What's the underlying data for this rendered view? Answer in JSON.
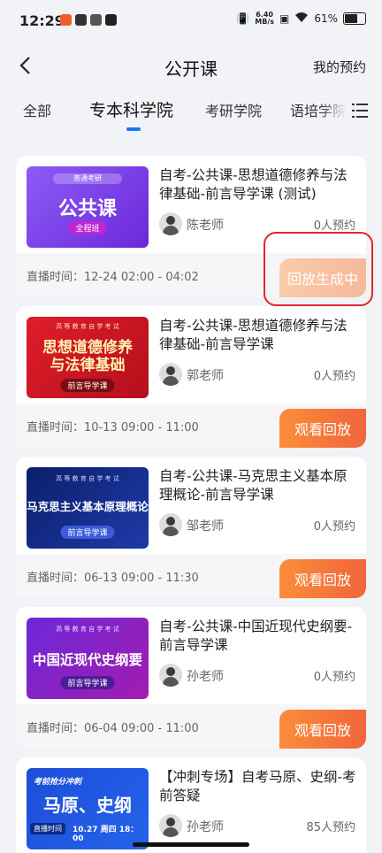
{
  "status": {
    "time": "12:29",
    "net_speed_top": "6.40",
    "net_speed_unit": "MB/s",
    "battery": "61%"
  },
  "nav": {
    "title": "公开课",
    "my_reservations": "我的预约"
  },
  "tabs": [
    {
      "label": "全部"
    },
    {
      "label": "专本科学院",
      "active": true
    },
    {
      "label": "考研学院"
    },
    {
      "label": "语培学院"
    }
  ],
  "courses": [
    {
      "title": "自考-公共课-思想道德修养与法律基础-前言导学课 (测试)",
      "teacher": "陈老师",
      "count": "0人预约",
      "airtime": "直播时间：12-24 02:00 - 04:02",
      "button": "回放生成中",
      "thumb": {
        "small": "普通考研",
        "main": "公共课",
        "pill": "全程班"
      }
    },
    {
      "title": "自考-公共课-思想道德修养与法律基础-前言导学课",
      "teacher": "郭老师",
      "count": "0人预约",
      "airtime": "直播时间：10-13 09:00 - 11:00",
      "button": "观看回放",
      "thumb": {
        "small": "高 等 教 育 自 学 考 试",
        "main1": "思想道德修养",
        "main2": "与法律基础",
        "pill": "前言导学课"
      }
    },
    {
      "title": "自考-公共课-马克思主义基本原理概论-前言导学课",
      "teacher": "邹老师",
      "count": "0人预约",
      "airtime": "直播时间：06-13 09:00 - 11:30",
      "button": "观看回放",
      "thumb": {
        "small": "高 等 教 育 自 学 考 试",
        "main": "马克思主义基本原理概论",
        "pill": "前言导学课"
      }
    },
    {
      "title": "自考-公共课-中国近现代史纲要-前言导学课",
      "teacher": "孙老师",
      "count": "0人预约",
      "airtime": "直播时间：06-04 09:00 - 11:00",
      "button": "观看回放",
      "thumb": {
        "small": "高 等 教 育 自 学 考 试",
        "main": "中国近现代史纲要",
        "pill": "前言导学课"
      }
    },
    {
      "title": "【冲刺专场】自考马原、史纲-考前答疑",
      "teacher": "孙老师",
      "count": "85人预约",
      "thumb": {
        "small": "考前抢分冲刺",
        "main": "马原、史纲",
        "pill": "直播时间",
        "date": "10.27 周四 18：00"
      }
    }
  ],
  "colors": {
    "accent": "#1677ff",
    "button": "#f1653a",
    "highlight": "#e3262b"
  }
}
